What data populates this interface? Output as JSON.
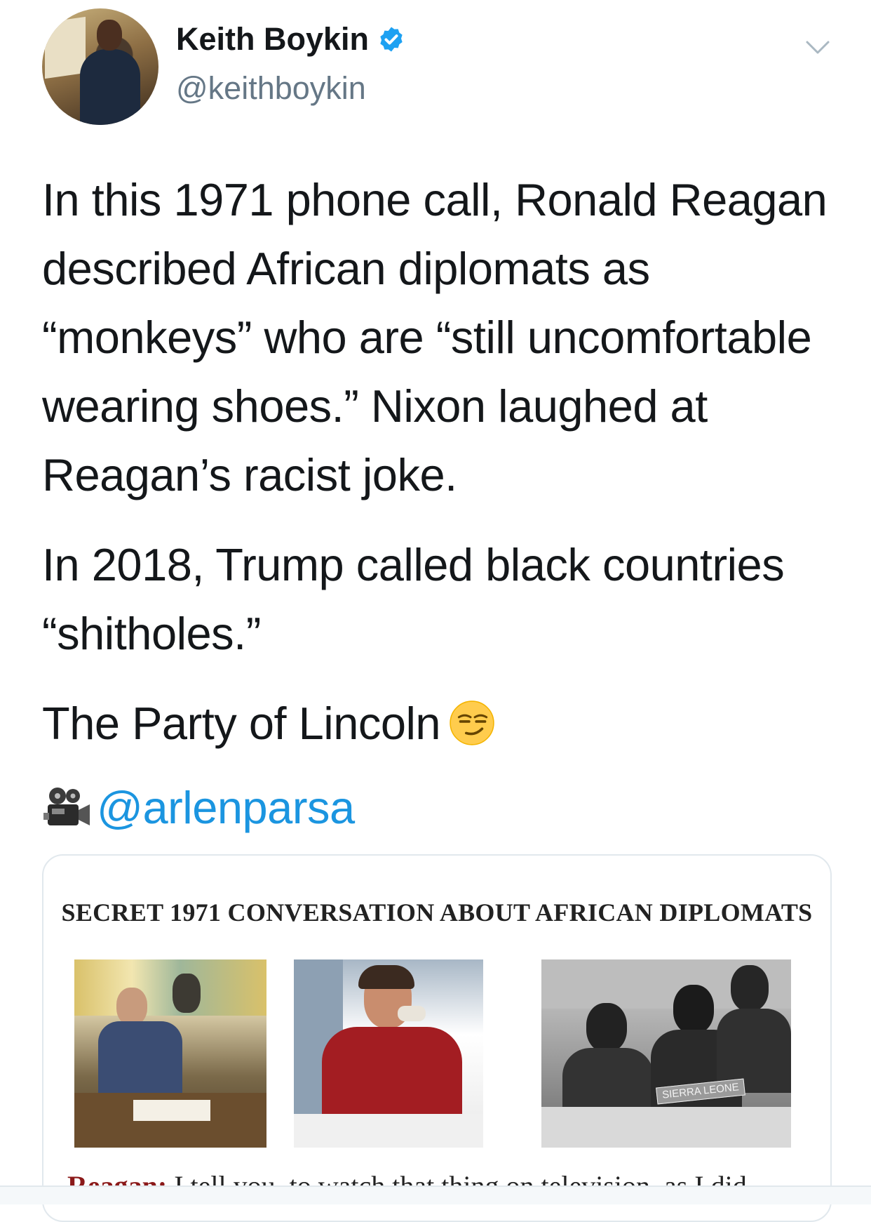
{
  "author": {
    "display_name": "Keith Boykin",
    "handle": "@keithboykin"
  },
  "tweet": {
    "paragraphs": [
      "In this 1971 phone call, Ronald Reagan described African diplomats as “monkeys” who are “still uncomfortable wearing shoes.” Nixon laughed at Reagan’s racist joke.",
      "In 2018, Trump called black countries “shitholes.”",
      "The Party of Lincoln"
    ],
    "mention": "@arlenparsa"
  },
  "media_card": {
    "title": "SECRET 1971 CONVERSATION ABOUT AFRICAN DIPLOMATS",
    "photo_placard": "SIERRA LEONE",
    "transcript_speaker": "Reagan:",
    "transcript_line": "I tell you, to watch that thing on television, as I did"
  },
  "icons": {
    "verified": "verified-badge-icon",
    "caret": "chevron-down-icon",
    "emoji": "smirking-face-emoji",
    "camera": "movie-camera-emoji"
  },
  "colors": {
    "link": "#1b95e0",
    "secondary_text": "#657786",
    "verified": "#1da1f2"
  }
}
